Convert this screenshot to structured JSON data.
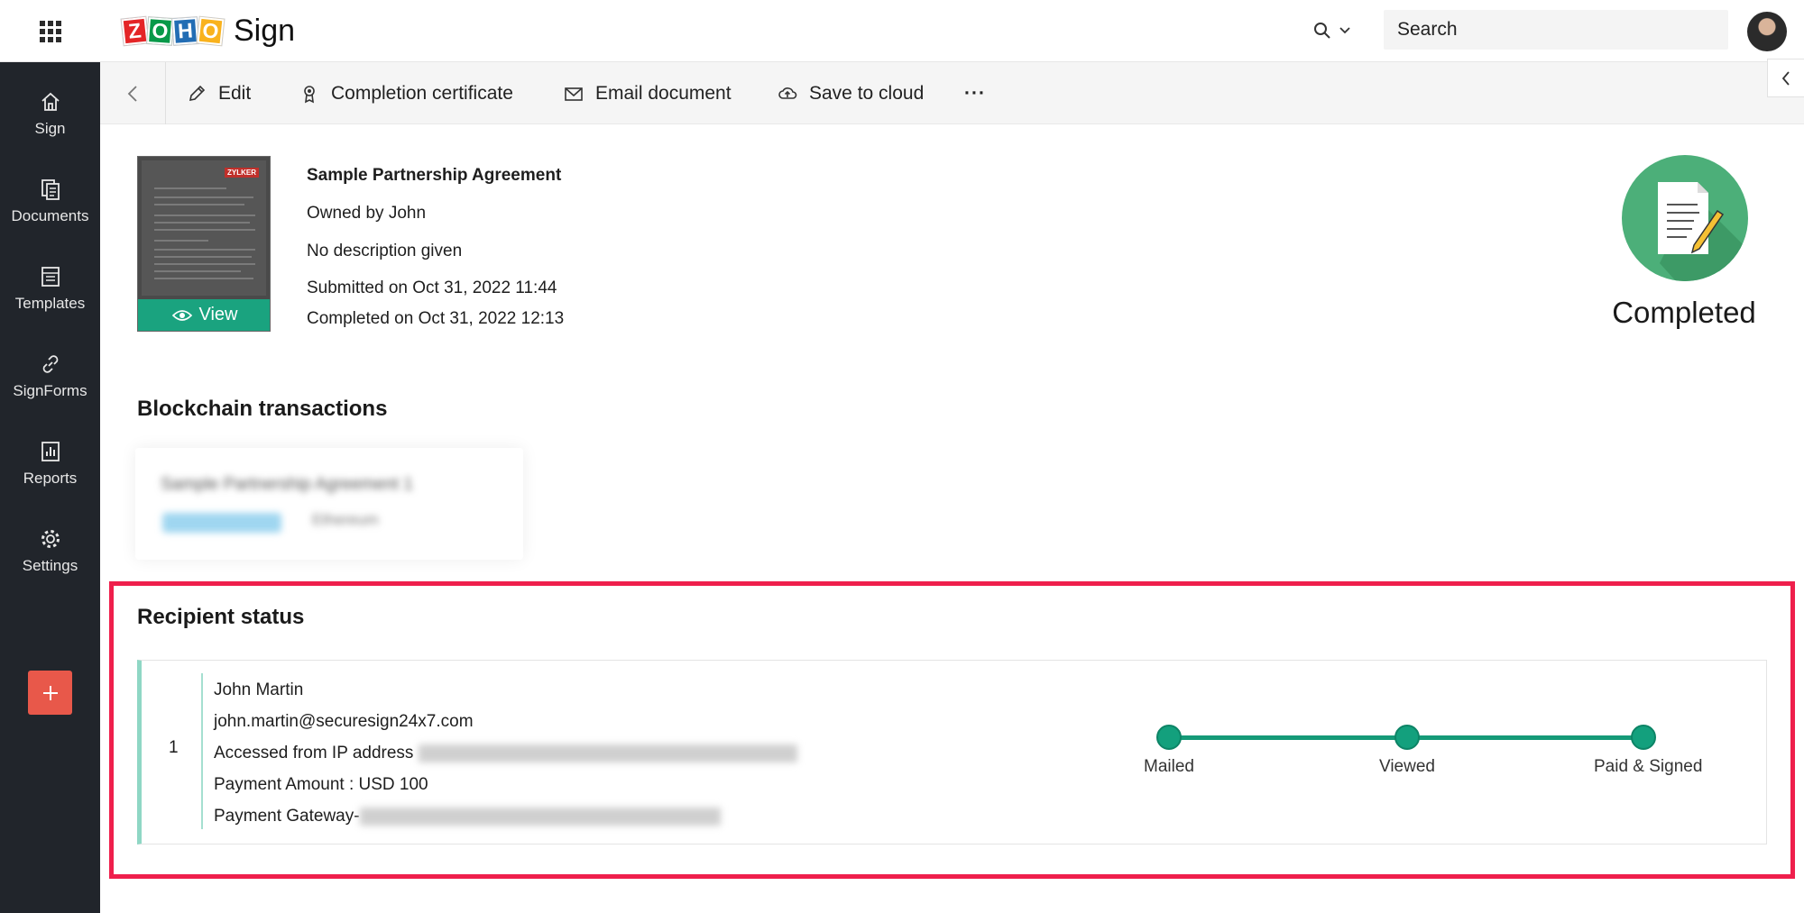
{
  "app": {
    "name": "Sign",
    "logo_letters": [
      "Z",
      "O",
      "H",
      "O"
    ]
  },
  "header": {
    "search_placeholder": "Search"
  },
  "sidebar": {
    "items": [
      {
        "label": "Sign",
        "icon": "home-icon"
      },
      {
        "label": "Documents",
        "icon": "documents-icon"
      },
      {
        "label": "Templates",
        "icon": "templates-icon"
      },
      {
        "label": "SignForms",
        "icon": "link-icon"
      },
      {
        "label": "Reports",
        "icon": "reports-icon"
      },
      {
        "label": "Settings",
        "icon": "gear-icon"
      }
    ],
    "add_label": "+"
  },
  "toolbar": {
    "edit": "Edit",
    "certificate": "Completion certificate",
    "email": "Email document",
    "save_cloud": "Save to cloud",
    "more": "···"
  },
  "document": {
    "title": "Sample Partnership Agreement",
    "owner": "Owned by John",
    "description": "No description given",
    "submitted": "Submitted on Oct 31, 2022 11:44",
    "completed": "Completed on Oct 31, 2022 12:13",
    "view_label": "View",
    "thumb_brand": "ZYLKER",
    "status": "Completed"
  },
  "blockchain": {
    "title": "Blockchain transactions",
    "card_title": "Sample Partnership Agreement 1",
    "card_sub": "Ethereum"
  },
  "recipients": {
    "title": "Recipient status",
    "items": [
      {
        "index": "1",
        "name": "John Martin",
        "email": "john.martin@securesign24x7.com",
        "ip_label": "Accessed from IP address",
        "payment_amount": "Payment Amount : USD 100",
        "payment_gateway": "Payment Gateway-"
      }
    ],
    "steps": [
      "Mailed",
      "Viewed",
      "Paid & Signed"
    ]
  },
  "colors": {
    "sidebar_bg": "#21252b",
    "accent_green": "#1aa37f",
    "highlight_red": "#ef1f4c",
    "add_button": "#e8584a"
  }
}
